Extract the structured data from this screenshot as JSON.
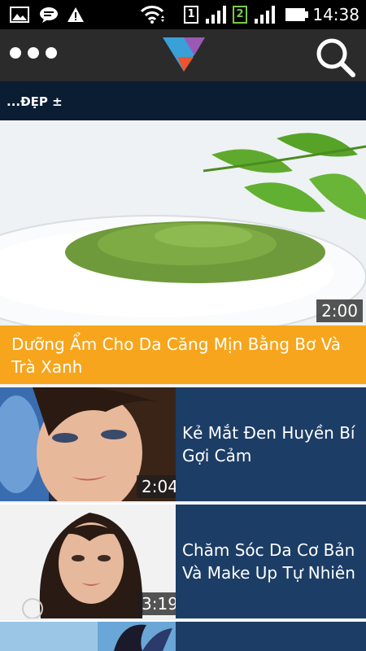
{
  "status_bar": {
    "time": "14:38",
    "sim1_label": "1",
    "sim2_label": "2",
    "icons": [
      "gallery-icon",
      "message-icon",
      "warning-icon",
      "wifi-icon",
      "sim1-signal-icon",
      "sim2-signal-icon",
      "battery-icon"
    ]
  },
  "app_bar": {
    "menu_icon": "more-dots-icon",
    "logo_icon": "app-logo-icon",
    "search_icon": "search-icon"
  },
  "section": {
    "title": "...ĐẸP ±"
  },
  "featured": {
    "title": "Dưỡng Ẩm Cho Da Căng Mịn Bằng Bơ Và Trà Xanh",
    "duration": "2:00"
  },
  "videos": [
    {
      "title": "Kẻ Mắt Đen Huyền Bí Gợi Cảm",
      "duration": "2:04"
    },
    {
      "title": "Chăm Sóc Da Cơ Bản Và Make Up Tự Nhiên",
      "duration": "3:19"
    }
  ],
  "colors": {
    "status_bar": "#000000",
    "app_bar": "#2b2b2b",
    "section_header": "#0b1d33",
    "featured_title_bg": "#f7a51c",
    "row_bg": "#1c3d66"
  }
}
